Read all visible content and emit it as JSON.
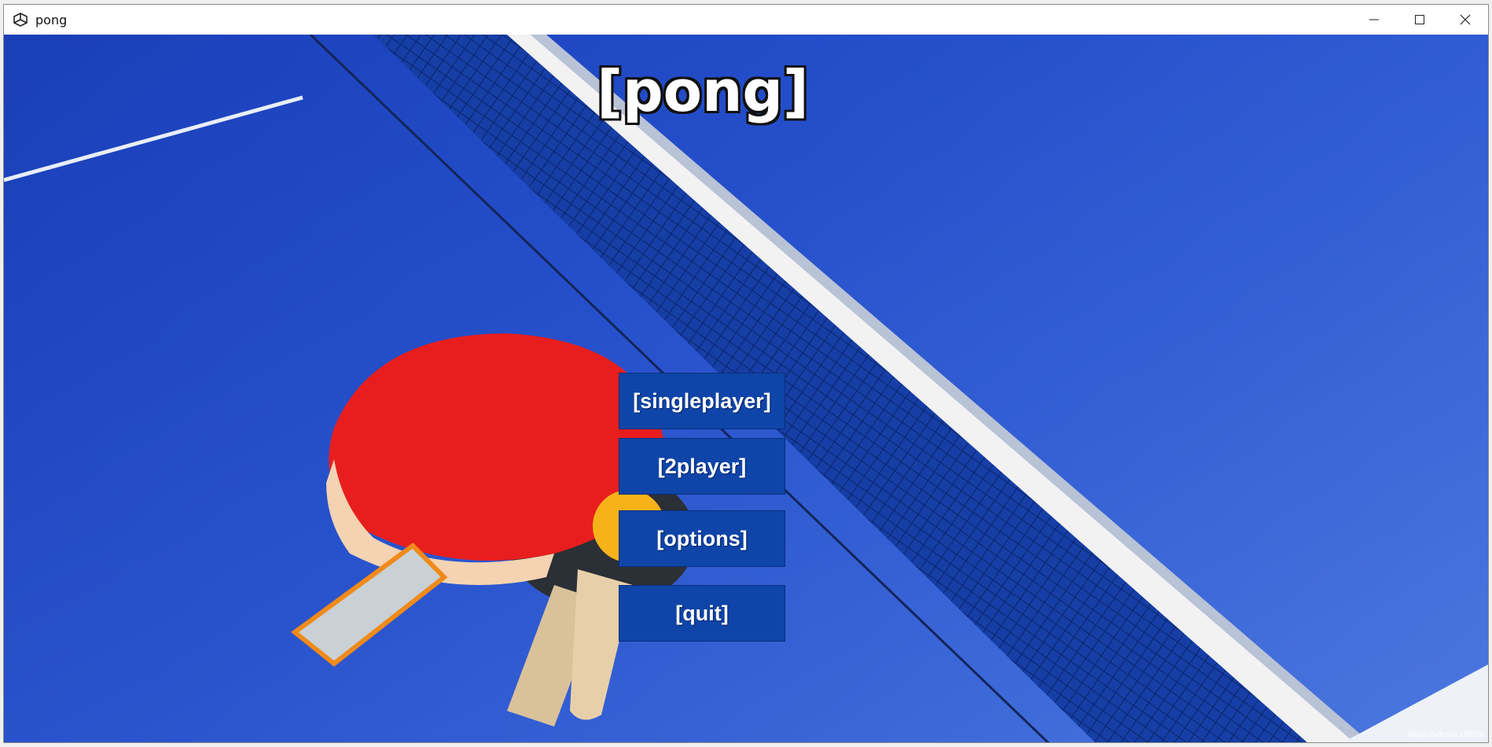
{
  "window": {
    "title": "pong"
  },
  "game": {
    "title": "[pong]"
  },
  "menu": {
    "singleplayer": "[singleplayer]",
    "two_player": "[2player]",
    "options": "[options]",
    "quit": "[quit]"
  },
  "footer": {
    "credit": "Milan Zivkovic 159/15"
  },
  "colors": {
    "button_bg": "#0f45a8",
    "table_blue": "#1f48c6",
    "paddle_red": "#e81e1e",
    "ball_yellow": "#f7b21a"
  }
}
